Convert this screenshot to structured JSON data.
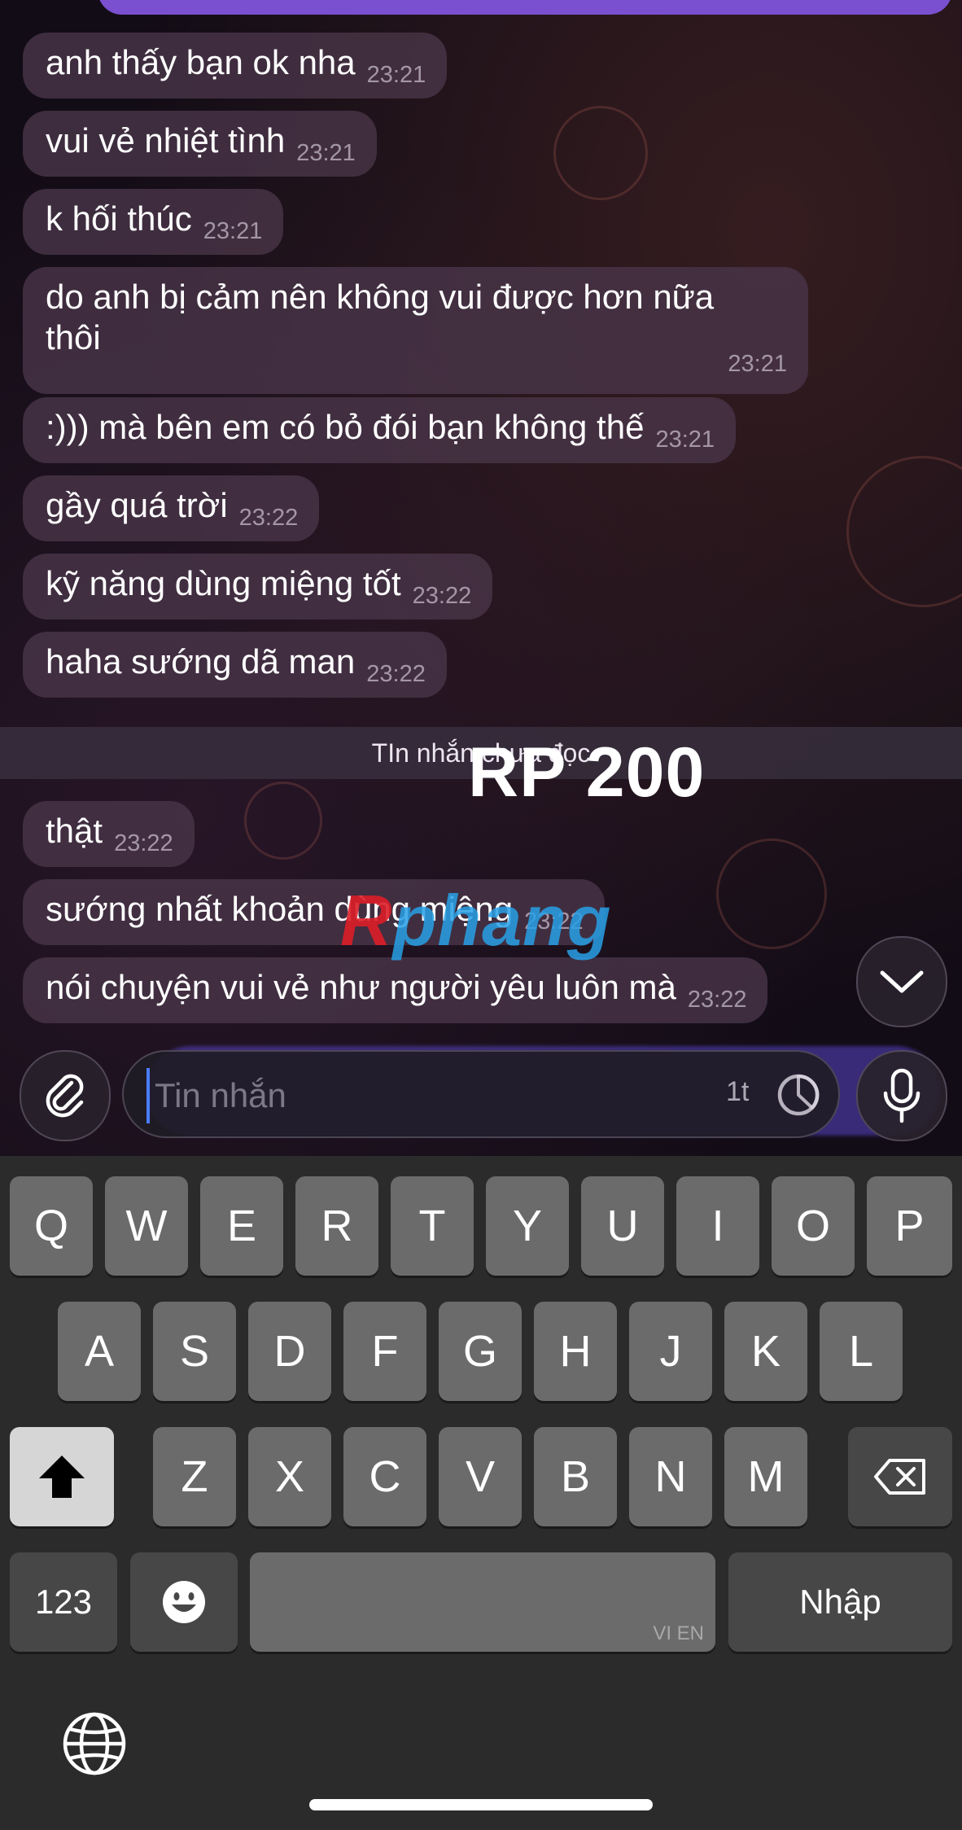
{
  "chat": {
    "messages": [
      {
        "text": "anh thấy bạn ok nha",
        "time": "23:21"
      },
      {
        "text": "vui vẻ nhiệt tình",
        "time": "23:21"
      },
      {
        "text": "k hối thúc",
        "time": "23:21"
      },
      {
        "text": "do anh bị cảm nên không vui được hơn nữa\nthôi",
        "time": "23:21"
      },
      {
        "text": ":))) mà bên em có bỏ đói bạn không thế",
        "time": "23:21"
      },
      {
        "text": "gầy quá trời",
        "time": "23:22"
      },
      {
        "text": "kỹ năng dùng miệng tốt",
        "time": "23:22"
      },
      {
        "text": "haha sướng dã man",
        "time": "23:22"
      },
      {
        "text": "thật",
        "time": "23:22"
      },
      {
        "text": "sướng nhất khoản dùng miệng",
        "time": "23:22"
      },
      {
        "text": "nói chuyện vui vẻ như người yêu luôn mà",
        "time": "23:22"
      }
    ],
    "unread_divider": "TIn nhắn chưa đọc",
    "watermark_text": "RP 200",
    "watermark_logo_red": "R",
    "watermark_logo_blue": "phang"
  },
  "composer": {
    "placeholder": "Tin nhắn",
    "timer_label": "1t",
    "attach_icon": "paperclip-icon",
    "timer_icon": "timer-icon",
    "mic_icon": "microphone-icon",
    "scroll_icon": "chevron-down-icon"
  },
  "keyboard": {
    "row1": [
      "Q",
      "W",
      "E",
      "R",
      "T",
      "Y",
      "U",
      "I",
      "O",
      "P"
    ],
    "row2": [
      "A",
      "S",
      "D",
      "F",
      "G",
      "H",
      "J",
      "K",
      "L"
    ],
    "row3": [
      "Z",
      "X",
      "C",
      "V",
      "B",
      "N",
      "M"
    ],
    "numbers_label": "123",
    "return_label": "Nhập",
    "space_hint": "VI EN",
    "shift_icon": "shift-icon",
    "delete_icon": "backspace-icon",
    "emoji_icon": "emoji-icon",
    "globe_icon": "globe-icon"
  }
}
